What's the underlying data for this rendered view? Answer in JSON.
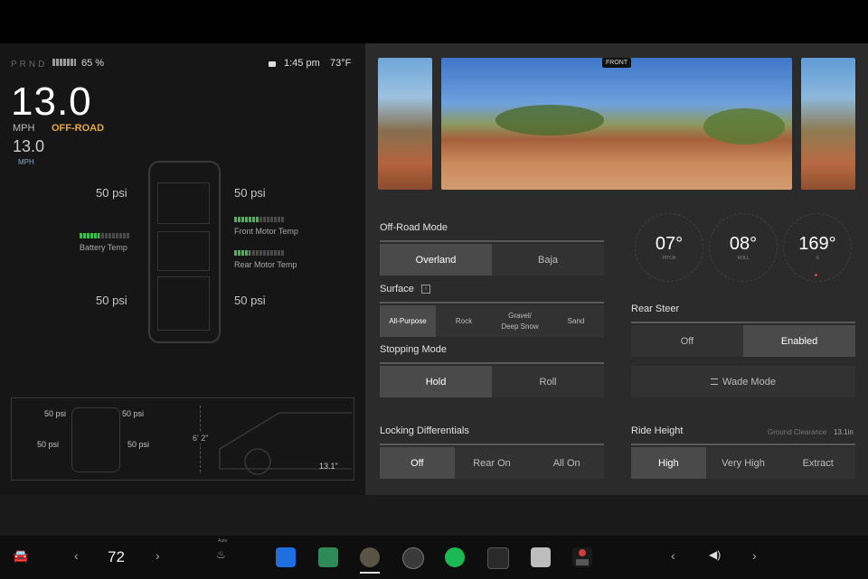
{
  "status": {
    "gears": "PRND",
    "battery_pct": "65 %",
    "battery_level": 0.65,
    "time": "1:45 pm",
    "temp": "73°F"
  },
  "drive": {
    "speed": "13.0",
    "unit": "MPH",
    "mode": "OFF-ROAD",
    "speed_secondary": "13.0",
    "unit_secondary": "MPH"
  },
  "tires": {
    "front_left": "50 psi",
    "front_right": "50 psi",
    "rear_left": "50 psi",
    "rear_right": "50 psi"
  },
  "temps": {
    "battery": "Battery Temp",
    "battery_level": 0.4,
    "front_motor": "Front Motor Temp",
    "front_motor_level": 0.5,
    "rear_motor": "Rear Motor Temp",
    "rear_motor_level": 0.3
  },
  "profile": {
    "psi_fl": "50 psi",
    "psi_fr": "50 psi",
    "psi_rl": "50 psi",
    "psi_rr": "50 psi",
    "height": "6' 2\"",
    "clearance": "13.1\""
  },
  "camera": {
    "front_label": "FRONT"
  },
  "offroad_mode": {
    "title": "Off-Road Mode",
    "options": [
      "Overland",
      "Baja"
    ],
    "selected": 0
  },
  "surface": {
    "title": "Surface",
    "options": [
      "All-Purpose",
      "Rock",
      "Gravel/\nDeep Snow",
      "Sand"
    ],
    "selected": 0
  },
  "stopping_mode": {
    "title": "Stopping Mode",
    "options": [
      "Hold",
      "Roll"
    ],
    "selected": 0
  },
  "locking_diff": {
    "title": "Locking Differentials",
    "options": [
      "Off",
      "Rear On",
      "All On"
    ],
    "selected": 0
  },
  "gauges": [
    {
      "value": "07°",
      "label": "PITCH"
    },
    {
      "value": "08°",
      "label": "ROLL"
    },
    {
      "value": "169°",
      "label": "S"
    }
  ],
  "rear_steer": {
    "title": "Rear Steer",
    "options": [
      "Off",
      "Enabled"
    ],
    "selected": 1
  },
  "wade_mode": "Wade Mode",
  "ride_height": {
    "title": "Ride Height",
    "clearance_label": "Ground Clearance",
    "clearance_value": "13.1in",
    "options": [
      "High",
      "Very High",
      "Extract"
    ],
    "selected": 0
  },
  "dock": {
    "climate_temp": "72",
    "seat_label": "Auto"
  },
  "colors": {
    "accent_offroad": "#e3a93d",
    "green_bar": "#3fb950",
    "selected_segment": "#4a4a4b"
  }
}
